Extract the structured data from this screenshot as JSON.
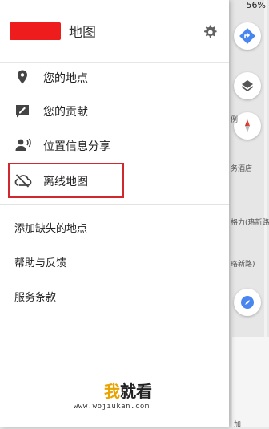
{
  "status": {
    "battery": "56%"
  },
  "header": {
    "title": "地图"
  },
  "menu": {
    "items": [
      {
        "label": "您的地点",
        "icon": "location-pin-icon"
      },
      {
        "label": "您的贡献",
        "icon": "contribution-icon"
      },
      {
        "label": "位置信息分享",
        "icon": "location-sharing-icon"
      },
      {
        "label": "离线地图",
        "icon": "cloud-off-icon"
      }
    ],
    "secondary": [
      {
        "label": "添加缺失的地点"
      },
      {
        "label": "帮助与反馈"
      },
      {
        "label": "服务条款"
      }
    ]
  },
  "map": {
    "labels": [
      "例",
      "务酒店",
      "格力(珞新路",
      "珞新路)",
      "加"
    ]
  },
  "watermark": {
    "brand_accent": "我",
    "brand_rest": "就看",
    "url": "www.wojiukan.com"
  },
  "colors": {
    "highlight": "#d0282f",
    "logo": "#ee1c1c",
    "directions": "#4a86f0"
  }
}
